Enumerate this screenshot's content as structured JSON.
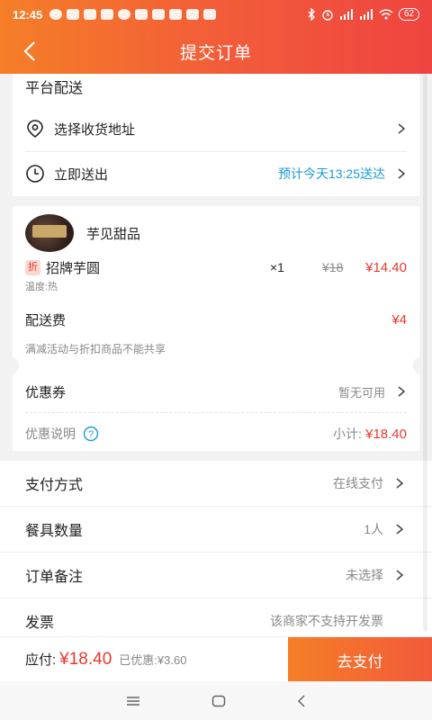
{
  "status": {
    "time": "12:45",
    "battery": "62"
  },
  "nav": {
    "title": "提交订单"
  },
  "delivery": {
    "platform_label": "平台配送",
    "address_label": "选择收货地址",
    "time_label": "立即送出",
    "eta": "预计今天13:25送达"
  },
  "shop": {
    "name": "芋见甜品",
    "item": {
      "discount_tag": "折",
      "name": "招牌芋圆",
      "qty": "×1",
      "orig_price": "¥18",
      "price": "¥14.40",
      "spec": "温度:热"
    },
    "delivery_fee_label": "配送费",
    "delivery_fee": "¥4",
    "promo_note": "满减活动与折扣商品不能共享",
    "coupon_label": "优惠券",
    "coupon_value": "暂无可用",
    "discount_info_label": "优惠说明",
    "subtotal_label": "小计:",
    "subtotal": "¥18.40"
  },
  "options": [
    {
      "label": "支付方式",
      "value": "在线支付"
    },
    {
      "label": "餐具数量",
      "value": "1人"
    },
    {
      "label": "订单备注",
      "value": "未选择"
    },
    {
      "label": "发票",
      "value": "该商家不支持开发票"
    }
  ],
  "footer": {
    "payable_label": "应付:",
    "payable": "¥18.40",
    "saved": "已优惠:¥3.60",
    "pay_button": "去支付"
  },
  "colors": {
    "accent": "#f25a3a",
    "price_red": "#e9392b",
    "eta_blue": "#1a9bd6"
  }
}
